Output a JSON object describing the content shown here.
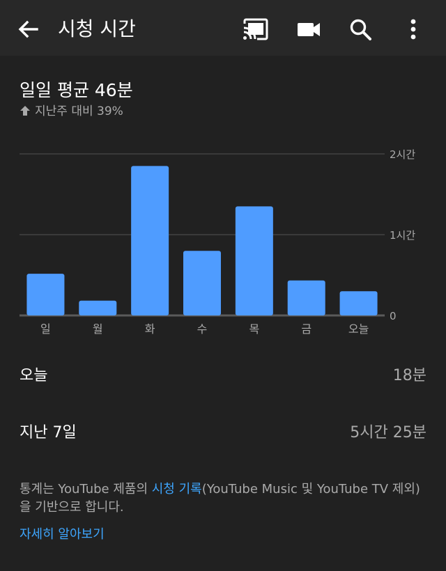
{
  "appbar": {
    "title": "시청 시간",
    "icons": [
      "back-arrow-icon",
      "cast-icon",
      "video-camera-icon",
      "search-icon",
      "more-vert-icon"
    ]
  },
  "summary": {
    "title": "일일 평균 46분",
    "change_icon": "arrow-up-icon",
    "change_text": "지난주 대비 39%"
  },
  "chart_data": {
    "type": "bar",
    "categories": [
      "일",
      "월",
      "화",
      "수",
      "목",
      "금",
      "오늘"
    ],
    "values": [
      31,
      11,
      111,
      48,
      81,
      26,
      18
    ],
    "value_unit": "minutes",
    "ylim": [
      0,
      120
    ],
    "yticks": [
      {
        "value": 0,
        "label": "0"
      },
      {
        "value": 60,
        "label": "1시간"
      },
      {
        "value": 120,
        "label": "2시간"
      }
    ],
    "grid": true,
    "bar_color": "#4f9cff"
  },
  "stats": {
    "today_label": "오늘",
    "today_value": "18분",
    "week_label": "지난 7일",
    "week_value": "5시간 25분"
  },
  "note": {
    "part1": "통계는 YouTube 제품의 ",
    "link": "시청 기록",
    "part2": "(YouTube Music 및 YouTube TV 제외)을 기반으로 합니다.",
    "learn_more": "자세히 알아보기"
  },
  "colors": {
    "background": "#212121",
    "appbar": "#282828",
    "link": "#3ea6ff",
    "secondary_text": "#aaaaaa"
  }
}
